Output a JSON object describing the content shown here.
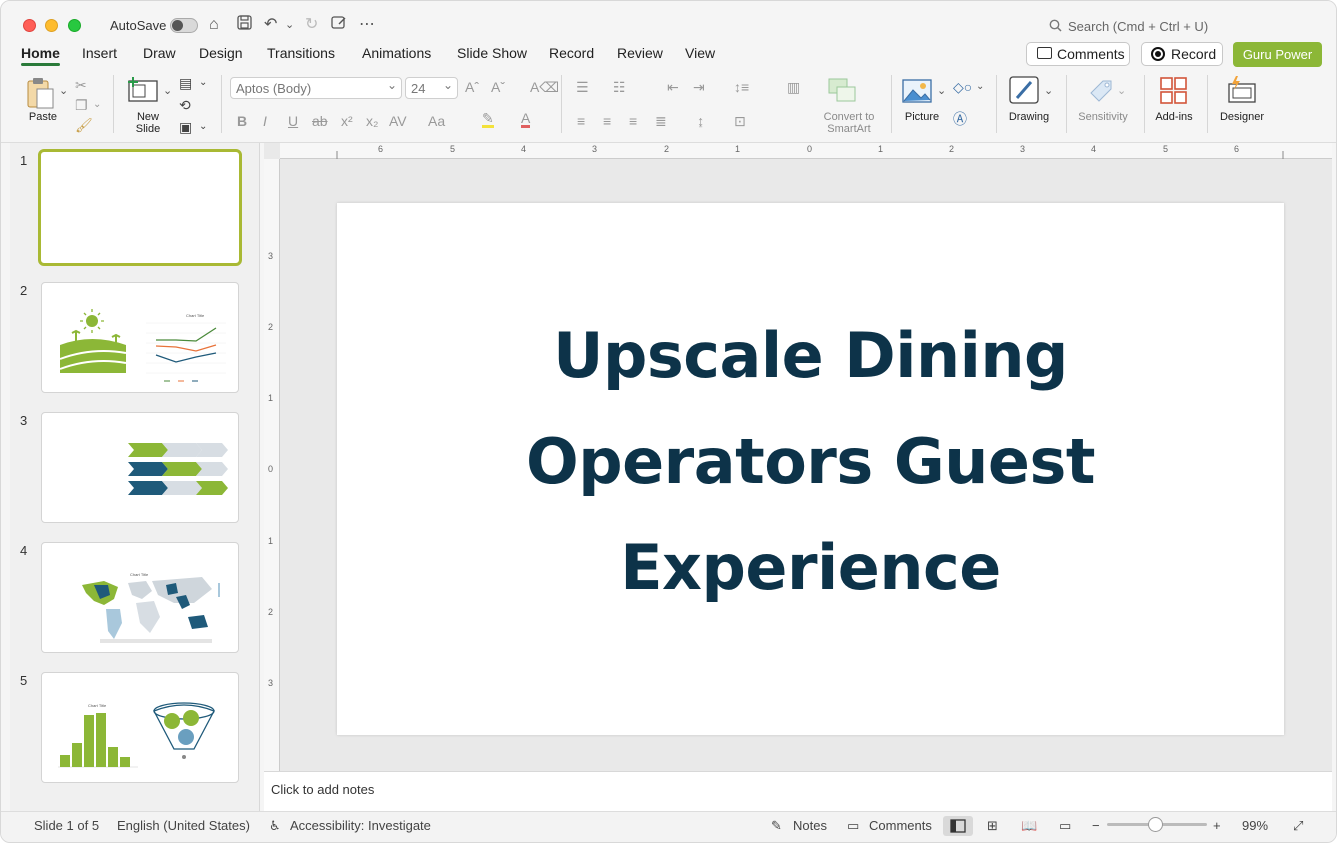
{
  "titlebar": {
    "autosave_label": "AutoSave",
    "search_placeholder": "Search (Cmd + Ctrl + U)"
  },
  "tabs": [
    "Home",
    "Insert",
    "Draw",
    "Design",
    "Transitions",
    "Animations",
    "Slide Show",
    "Record",
    "Review",
    "View"
  ],
  "header_buttons": {
    "comments": "Comments",
    "record": "Record",
    "guru": "Guru Power"
  },
  "ribbon": {
    "paste": "Paste",
    "new_slide": [
      "New",
      "Slide"
    ],
    "font_name": "Aptos (Body)",
    "font_size": "24",
    "convert": [
      "Convert to",
      "SmartArt"
    ],
    "picture": "Picture",
    "drawing": "Drawing",
    "sensitivity": "Sensitivity",
    "addins": "Add-ins",
    "designer": "Designer"
  },
  "thumbnails": [
    {
      "number": "1"
    },
    {
      "number": "2"
    },
    {
      "number": "3"
    },
    {
      "number": "4"
    },
    {
      "number": "5"
    }
  ],
  "ruler": {
    "horizontal": [
      "6",
      "5",
      "4",
      "3",
      "2",
      "1",
      "0",
      "1",
      "2",
      "3",
      "4",
      "5",
      "6"
    ],
    "vertical": [
      "3",
      "2",
      "1",
      "0",
      "1",
      "2",
      "3"
    ]
  },
  "slide": {
    "title_lines": [
      "Upscale Dining",
      "Operators Guest",
      "Experience"
    ],
    "title_color": "#0d3349"
  },
  "notes_placeholder": "Click to add notes",
  "status": {
    "slide_count": "Slide 1 of 5",
    "language": "English (United States)",
    "accessibility": "Accessibility: Investigate",
    "notes": "Notes",
    "comments": "Comments",
    "zoom": "99%"
  },
  "colors": {
    "accent_green": "#8cb737",
    "navy": "#0d3349",
    "chart_blue": "#1f5a7a"
  }
}
